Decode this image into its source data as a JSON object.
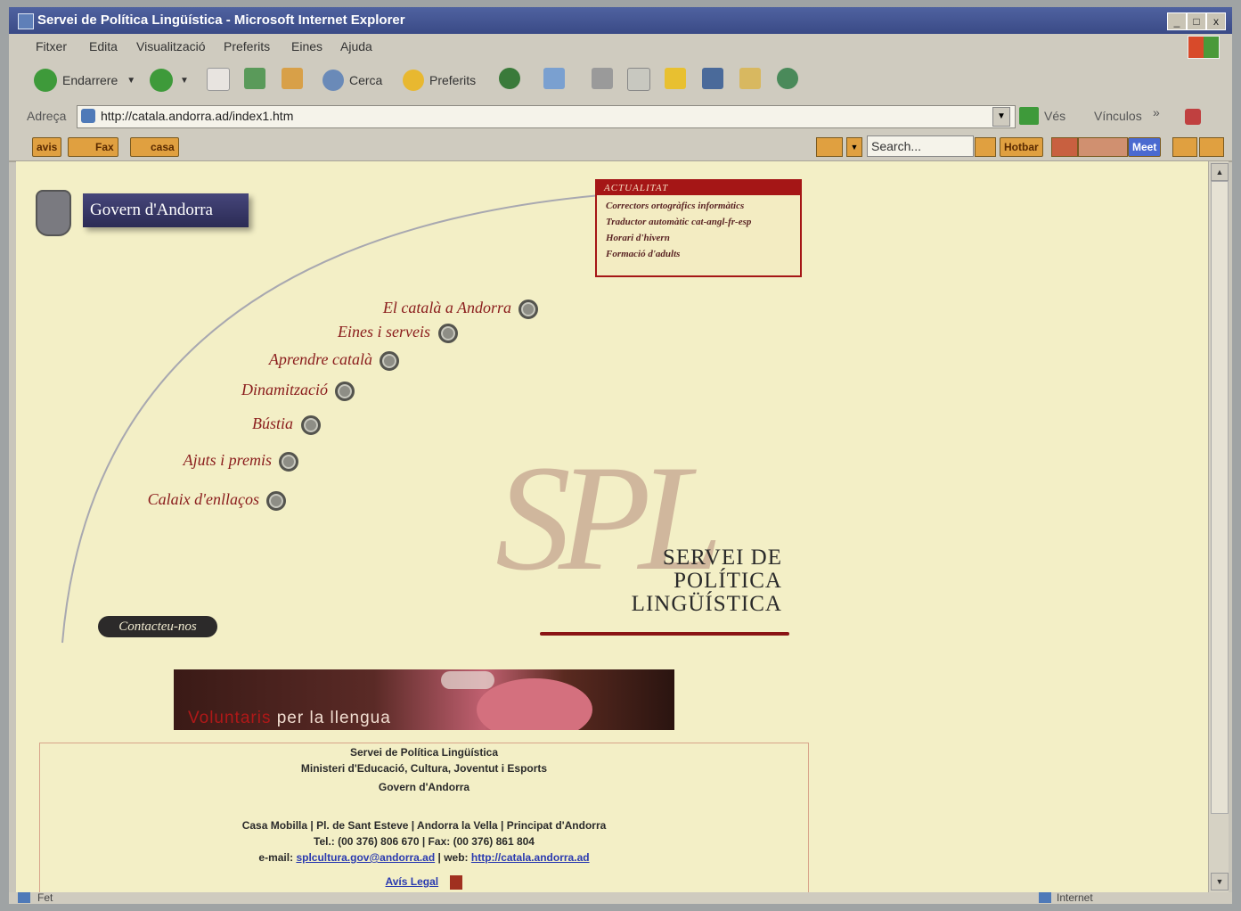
{
  "window": {
    "title": "Servei de Política Lingüística - Microsoft Internet Explorer",
    "min_label": "_",
    "max_label": "□",
    "close_label": "x"
  },
  "menu": [
    "Fitxer",
    "Edita",
    "Visualització",
    "Preferits",
    "Eines",
    "Ajuda"
  ],
  "toolbar": {
    "back_label": "Endarrere",
    "search_label": "Cerca",
    "favorites_label": "Preferits"
  },
  "address": {
    "label": "Adreça",
    "url": "http://catala.andorra.ad/index1.htm",
    "go_label": "Vés",
    "links_label": "Vínculos",
    "chevron": "»"
  },
  "linksbar": {
    "avis": "avis",
    "fax": "Fax",
    "casa": "casa",
    "search_placeholder": "Search...",
    "hotbar": "Hotbar",
    "meet": "Meet"
  },
  "page": {
    "gov_banner": "Govern d'Andorra",
    "news": {
      "header": "ACTUALITAT",
      "items": [
        "Correctors ortogràfics informàtics",
        "Traductor automàtic cat-angl-fr-esp",
        "Horari d'hivern",
        "Formació d'adults"
      ]
    },
    "menu_links": [
      "El català a Andorra",
      "Eines i serveis",
      "Aprendre català",
      "Dinamització",
      "Bústia",
      "Ajuts i premis",
      "Calaix d'enllaços"
    ],
    "contact": "Contacteu-nos",
    "spl_logo": "SPL",
    "spl_title": [
      "SERVEI DE",
      "POLÍTICA",
      "LINGÜÍSTICA"
    ],
    "volunteers": {
      "part1": "Voluntaris",
      "part2": " per la llengua"
    },
    "footer": {
      "line1": "Servei de Política Lingüística",
      "line2": "Ministeri d'Educació, Cultura, Joventut i Esports",
      "line3": "Govern d'Andorra",
      "line4": "Casa Mobilla | Pl. de Sant Esteve | Andorra la Vella | Principat d'Andorra",
      "line5": "Tel.: (00 376) 806 670 | Fax: (00 376) 861 804",
      "email_label": "e-mail: ",
      "email": "splcultura.gov@andorra.ad",
      "web_label": " | web: ",
      "web": "http://catala.andorra.ad",
      "legal": "Avís Legal"
    }
  },
  "status": {
    "left": "Fet",
    "zone": "Internet"
  }
}
